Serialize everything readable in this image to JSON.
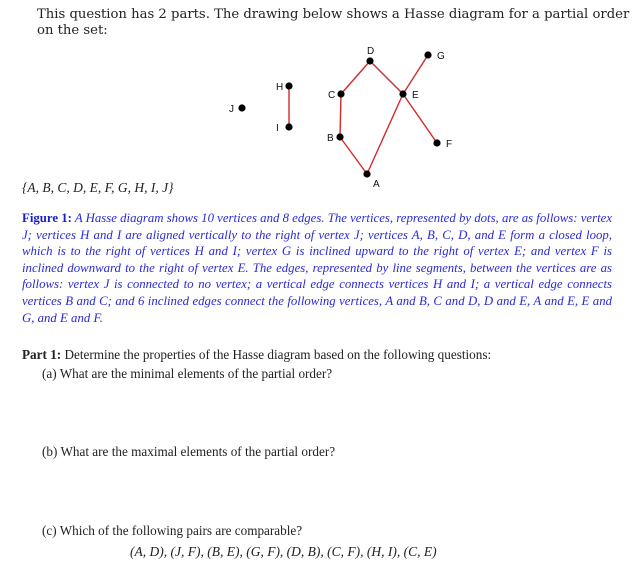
{
  "intro_text": "This question has 2 parts. The drawing below shows a Hasse diagram for a partial order on the set:",
  "diagram": {
    "edge_color": "#d42a2a",
    "vertex_color": "#000000",
    "vertices": [
      {
        "id": "J",
        "label": "J",
        "label_side": "left"
      },
      {
        "id": "H",
        "label": "H",
        "label_side": "left"
      },
      {
        "id": "I",
        "label": "I",
        "label_side": "left"
      },
      {
        "id": "D",
        "label": "D",
        "label_side": "top"
      },
      {
        "id": "C",
        "label": "C",
        "label_side": "left"
      },
      {
        "id": "B",
        "label": "B",
        "label_side": "left"
      },
      {
        "id": "A",
        "label": "A",
        "label_side": "bottom-right"
      },
      {
        "id": "E",
        "label": "E",
        "label_side": "right"
      },
      {
        "id": "G",
        "label": "G",
        "label_side": "right"
      },
      {
        "id": "F",
        "label": "F",
        "label_side": "right"
      }
    ],
    "edges": [
      [
        "H",
        "I"
      ],
      [
        "B",
        "C"
      ],
      [
        "A",
        "B"
      ],
      [
        "C",
        "D"
      ],
      [
        "D",
        "E"
      ],
      [
        "A",
        "E"
      ],
      [
        "E",
        "G"
      ],
      [
        "E",
        "F"
      ]
    ]
  },
  "set_text": "{A, B, C, D, E, F, G, H, I, J}",
  "caption": {
    "label": "Figure 1:",
    "text": "A Hasse diagram shows 10 vertices and 8 edges. The vertices, represented by dots, are as follows: vertex J; vertices H and I are aligned vertically to the right of vertex J; vertices A, B, C, D, and E form a closed loop, which is to the right of vertices H and I; vertex G is inclined upward to the right of vertex E; and vertex F is inclined downward to the right of vertex E. The edges, represented by line segments, between the vertices are as follows: vertex J is connected to no vertex; a vertical edge connects vertices H and I; a vertical edge connects vertices B and C; and 6 inclined edges connect the following vertices, A and B, C and D, D and E, A and E, E and G, and E and F."
  },
  "part1": {
    "label": "Part 1:",
    "text": "Determine the properties of the Hasse diagram based on the following questions:",
    "questions": [
      {
        "marker": "(a)",
        "text": "What are the minimal elements of the partial order?"
      },
      {
        "marker": "(b)",
        "text": "What are the maximal elements of the partial order?"
      },
      {
        "marker": "(c)",
        "text": "Which of the following pairs are comparable?"
      }
    ],
    "pairs_text": "(A, D), (J, F), (B, E), (G, F), (D, B), (C, F), (H, I), (C, E)"
  }
}
